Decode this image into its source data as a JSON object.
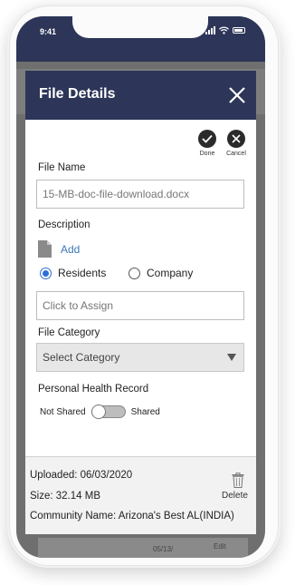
{
  "status_bar": {
    "time": "9:41"
  },
  "modal": {
    "title": "File Details",
    "done_label": "Done",
    "cancel_label": "Cancel",
    "file_name_label": "File Name",
    "file_name_value": "15-MB-doc-file-download.docx",
    "description_label": "Description",
    "add_label": "Add",
    "radio_residents": "Residents",
    "radio_company": "Company",
    "selected_radio": "Residents",
    "assign_placeholder": "Click to Assign",
    "file_category_label": "File Category",
    "category_selected": "Select Category",
    "phr_label": "Personal Health Record",
    "not_shared_label": "Not Shared",
    "shared_label": "Shared",
    "uploaded": "Uploaded: 06/03/2020",
    "size": "Size: 32.14 MB",
    "community": "Community Name: Arizona's Best AL(INDIA)",
    "delete_label": "Delete"
  },
  "background": {
    "edit_label": "Edit",
    "date_text": "05/13/"
  },
  "colors": {
    "header": "#2d3658",
    "link": "#3c78b8",
    "radio_accent": "#2d6fd8"
  }
}
